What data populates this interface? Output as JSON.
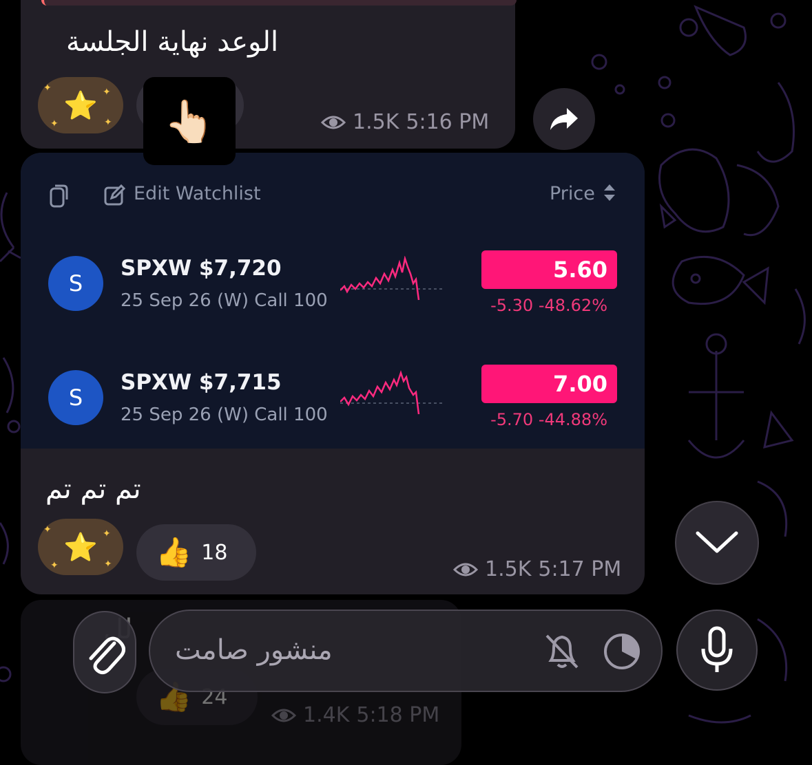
{
  "messages": [
    {
      "text": "الوعد نهاية الجلسة",
      "reaction_emoji": "⭐",
      "views": "1.5K",
      "time": "5:16 PM",
      "finger_emoji": "👆🏻"
    },
    {
      "watchlist": {
        "edit_label": "Edit Watchlist",
        "price_label": "Price",
        "rows": [
          {
            "avatar": "S",
            "symbol": "SPXW $7,720",
            "desc": "25 Sep 26 (W) Call 100",
            "price": "5.60",
            "change": "-5.30 -48.62%"
          },
          {
            "avatar": "S",
            "symbol": "SPXW $7,715",
            "desc": "25 Sep 26 (W) Call 100",
            "price": "7.00",
            "change": "-5.70 -44.88%"
          }
        ]
      },
      "text": "تم تم تم",
      "reaction_emoji": "⭐",
      "thumbs_emoji": "👍",
      "thumbs_count": "18",
      "views": "1.5K",
      "time": "5:17 PM"
    },
    {
      "text_partial": "لل",
      "thumbs_emoji": "👍",
      "thumbs_count": "24",
      "views": "1.4K",
      "time": "5:18 PM"
    }
  ],
  "composer": {
    "placeholder": "منشور صامت"
  },
  "colors": {
    "bubble": "#221f27",
    "watch_bg": "#101629",
    "price_box": "#ff1677",
    "negative": "#f1397a",
    "avatar": "#1d55c4",
    "doodle": "#2a1d46"
  },
  "icons": [
    "eye-icon",
    "share-icon",
    "copy-icon",
    "edit-icon",
    "sort-icon",
    "chevron-down-icon",
    "paperclip-icon",
    "bell-off-icon",
    "timer-icon",
    "microphone-icon"
  ]
}
